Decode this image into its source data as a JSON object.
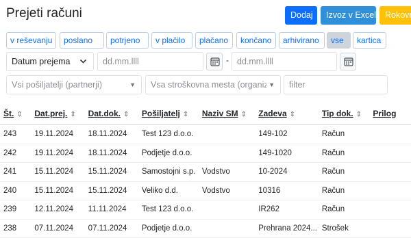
{
  "page": {
    "title": "Prejeti računi"
  },
  "buttons": {
    "add": "Dodaj",
    "export": "Izvoz v Excel",
    "terms": "Rokovnik"
  },
  "status_filters": [
    "v reševanju",
    "poslano",
    "potrjeno",
    "v plačilo",
    "plačano",
    "končano",
    "arhivirano",
    "vse",
    "kartica"
  ],
  "active_status": "vse",
  "date_filter": {
    "type_value": "Datum prejema",
    "from_placeholder": "dd.mm.llll",
    "separator": "-",
    "to_placeholder": "dd.mm.llll"
  },
  "sender_select": {
    "placeholder": "Vsi pošiljatelji (partnerji)"
  },
  "cost_center_select": {
    "placeholder": "Vsa stroškovna mesta (organiza"
  },
  "filter_input": {
    "placeholder": "filter"
  },
  "table": {
    "columns": [
      "Št.",
      "Dat.prej.",
      "Dat.dok.",
      "Pošiljatelj",
      "Naziv SM",
      "Zadeva",
      "Tip dok.",
      "Prilog"
    ],
    "rows": [
      [
        "243",
        "19.11.2024",
        "18.11.2024",
        "Test 123 d.o.o.",
        "",
        "149-102",
        "Račun",
        ""
      ],
      [
        "242",
        "19.11.2024",
        "18.11.2024",
        "Podjetje d.o.o.",
        "",
        "149-1020",
        "Račun",
        ""
      ],
      [
        "241",
        "15.11.2024",
        "15.11.2024",
        "Samostojni s.p.",
        "Vodstvo",
        "10-2024",
        "Račun",
        ""
      ],
      [
        "240",
        "15.11.2024",
        "15.11.2024",
        "Veliko d.d.",
        "Vodstvo",
        "10316",
        "Račun",
        ""
      ],
      [
        "239",
        "12.11.2024",
        "11.11.2024",
        "Test 123 d.o.o.",
        "",
        "IR262",
        "Račun",
        ""
      ],
      [
        "238",
        "07.11.2024",
        "07.11.2024",
        "Podjetje d.o.o.",
        "",
        "Prehrana 2024...",
        "Strošek",
        ""
      ]
    ]
  },
  "colors": {
    "primary": "#0d6efd",
    "excel": "#2f8fd8",
    "warning": "#ffc107",
    "active_filter": "#cdd4dc"
  }
}
